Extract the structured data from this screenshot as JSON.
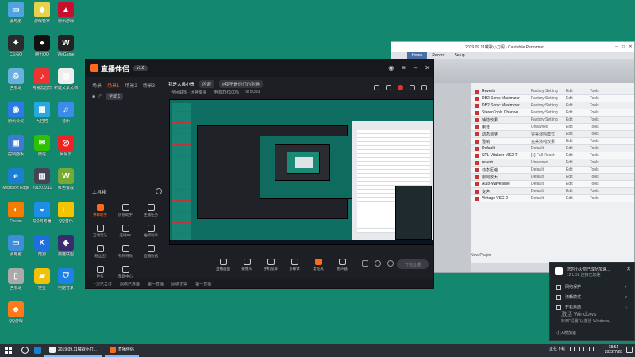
{
  "desktop": {
    "icons": [
      {
        "label": "此电脑",
        "color": "#4fa3e0",
        "glyph": "▭"
      },
      {
        "label": "游戏管家",
        "color": "#e8d24a",
        "glyph": "◆"
      },
      {
        "label": "腾讯游戏",
        "color": "#c8102e",
        "glyph": "▲"
      },
      {
        "label": "CS:GO",
        "color": "#2b2b2b",
        "glyph": "✦"
      },
      {
        "label": "腾讯QQ",
        "color": "#111",
        "glyph": "●"
      },
      {
        "label": "WeGame",
        "color": "#222",
        "glyph": "W"
      },
      {
        "label": "回收站",
        "color": "#6ab0de",
        "glyph": "♲"
      },
      {
        "label": "网易云音乐",
        "color": "#e33",
        "glyph": "♪"
      },
      {
        "label": "新建文本文档",
        "color": "#eee",
        "glyph": "▤"
      },
      {
        "label": "腾讯会议",
        "color": "#2a7be4",
        "glyph": "◉"
      },
      {
        "label": "九宫格",
        "color": "#27a8e0",
        "glyph": "▦"
      },
      {
        "label": "音乐",
        "color": "#3b8ce8",
        "glyph": "♫"
      },
      {
        "label": "控制面板",
        "color": "#3a7bd5",
        "glyph": "▣"
      },
      {
        "label": "微信",
        "color": "#2dc100",
        "glyph": "✉"
      },
      {
        "label": "网易云",
        "color": "#e22",
        "glyph": "◎"
      },
      {
        "label": "Microsoft Edge",
        "color": "#1b7fd1",
        "glyph": "e"
      },
      {
        "label": "2019.09.11",
        "color": "#445",
        "glyph": "▥"
      },
      {
        "label": "红色警戒",
        "color": "#7a3",
        "glyph": "W"
      },
      {
        "label": "Firefox",
        "color": "#f57c00",
        "glyph": "◐"
      },
      {
        "label": "QQ浏览器",
        "color": "#1e8de8",
        "glyph": "◒"
      },
      {
        "label": "QQ音乐",
        "color": "#f5c400",
        "glyph": "♩"
      },
      {
        "label": "此电脑",
        "color": "#3d8ed8",
        "glyph": "▭"
      },
      {
        "label": "酷狗",
        "color": "#1d6fe0",
        "glyph": "K"
      },
      {
        "label": "英雄联盟",
        "color": "#3a2a6e",
        "glyph": "◈"
      },
      {
        "label": "回收站",
        "color": "#aaa",
        "glyph": "▯"
      },
      {
        "label": "便签",
        "color": "#f2c200",
        "glyph": "▰"
      },
      {
        "label": "电脑管家",
        "color": "#1f80e6",
        "glyph": "⛉"
      },
      {
        "label": "QQ游戏",
        "color": "#ff7a1a",
        "glyph": "☻"
      }
    ]
  },
  "cantabile": {
    "title": "2019.09.11喊歌小刀阁 - Cantabile Performer",
    "tabs": [
      "Home",
      "Record",
      "Setup"
    ],
    "plugins": [
      {
        "name": "Reverb",
        "preset": "Factory Setting",
        "ctl": "Edit",
        "tools": "Tools"
      },
      {
        "name": "DB2 Sonic Maximizer",
        "preset": "Factory Setting",
        "ctl": "Edit",
        "tools": "Tools"
      },
      {
        "name": "DB2 Sonic Maximizer",
        "preset": "Factory Setting",
        "ctl": "Edit",
        "tools": "Tools"
      },
      {
        "name": "StereoTools Channel",
        "preset": "Factory Setting",
        "ctl": "Edit",
        "tools": "Tools"
      },
      {
        "name": "辅助效果",
        "preset": "Factory Setting",
        "ctl": "Edit",
        "tools": "Tools"
      },
      {
        "name": "电音",
        "preset": "Unnamed",
        "ctl": "Edit",
        "tools": "Tools"
      },
      {
        "name": "动态调整",
        "preset": "完美演唱模式",
        "ctl": "Edit",
        "tools": "Tools"
      },
      {
        "name": "混响",
        "preset": "完美演唱效果",
        "ctl": "Edit",
        "tools": "Tools"
      },
      {
        "name": "Default",
        "preset": "Default",
        "ctl": "Edit",
        "tools": "Tools"
      },
      {
        "name": "SPL Vitalizer MK2-T",
        "preset": "[1] Full Reset",
        "ctl": "Edit",
        "tools": "Tools"
      },
      {
        "name": "reverb",
        "preset": "Unnamed",
        "ctl": "Edit",
        "tools": "Tools"
      },
      {
        "name": "动态压缩",
        "preset": "Default",
        "ctl": "Edit",
        "tools": "Tools"
      },
      {
        "name": "限制放大",
        "preset": "Default",
        "ctl": "Edit",
        "tools": "Tools"
      },
      {
        "name": "Auto-Wavesline",
        "preset": "Default",
        "ctl": "Edit",
        "tools": "Tools"
      },
      {
        "name": "变声",
        "preset": "Default",
        "ctl": "Edit",
        "tools": "Tools"
      },
      {
        "name": "Vintage VSC-2",
        "preset": "Default",
        "ctl": "Edit",
        "tools": "Tools"
      }
    ],
    "new_plugin": "New Plugin",
    "footer_row": "闪避"
  },
  "stream_app": {
    "app_name": "直播伴侣",
    "version": "v1.0",
    "scene_tabs": [
      "场景",
      "场景1",
      "场景2",
      "场景3"
    ],
    "scene_item": "全屏 1",
    "room_title": "我是大鼻小贵",
    "room_tag1": "闪避",
    "room_tag2": "#我不是你们的别卷",
    "room_meta": "全民联盟 · 大神做事",
    "room_meta2": "连线优化100%",
    "viewers": "975/393",
    "tools_title": "工具箱",
    "tools": [
      {
        "label": "弹幕助手",
        "hot": true
      },
      {
        "label": "房管助手",
        "hot": false
      },
      {
        "label": "主播任务",
        "hot": false
      },
      {
        "label": "互动玩法",
        "hot": false
      },
      {
        "label": "连线PK",
        "hot": false
      },
      {
        "label": "抽奖助手",
        "hot": false
      },
      {
        "label": "粉丝团",
        "hot": false
      },
      {
        "label": "礼物特效",
        "hot": false
      },
      {
        "label": "直播数据",
        "hot": false
      },
      {
        "label": "更多",
        "hot": false
      },
      {
        "label": "帮助中心",
        "hot": false
      }
    ],
    "controls": [
      "直播画面",
      "摄像头",
      "手机投屏",
      "多媒体",
      "麦克风",
      "扬声器"
    ],
    "go_live": "开始直播",
    "status": [
      "上次已关注",
      "网络已连接",
      "第一直播",
      "网络正常",
      "第一直播"
    ]
  },
  "notification": {
    "title": "您的小火箭已成功加速...",
    "subtitle": "12 LOL 连接已加速",
    "rows": [
      "网络保护",
      "流畅模式",
      "开机自动"
    ],
    "footer": "小火箭加速"
  },
  "watermark": {
    "line1": "激活 Windows",
    "line2": "转到\"设置\"以激活 Windows。"
  },
  "taskbar": {
    "task1": "2019.09.11喊歌小刀...",
    "task2": "直播伴侣",
    "tray_text": "正在下载",
    "time": "18:51",
    "date": "2022/7/28"
  }
}
